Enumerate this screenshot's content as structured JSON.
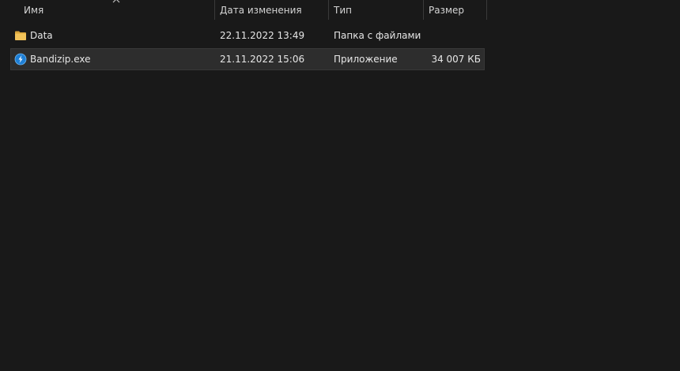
{
  "columns": {
    "name": "Имя",
    "date": "Дата изменения",
    "type": "Тип",
    "size": "Размер"
  },
  "sort": {
    "column": "name",
    "direction": "ascending",
    "icon": "chevron-up-icon"
  },
  "files": [
    {
      "name": "Data",
      "date": "22.11.2022 13:49",
      "type": "Папка с файлами",
      "size": "",
      "icon": "folder-icon",
      "selected": false
    },
    {
      "name": "Bandizip.exe",
      "date": "21.11.2022 15:06",
      "type": "Приложение",
      "size": "34 007 КБ",
      "icon": "bandizip-app-icon",
      "selected": true
    }
  ],
  "colors": {
    "background": "#191919",
    "selected_row": "#2d2d2d",
    "folder": "#e8b64a",
    "app_icon": "#1e7fd6"
  }
}
